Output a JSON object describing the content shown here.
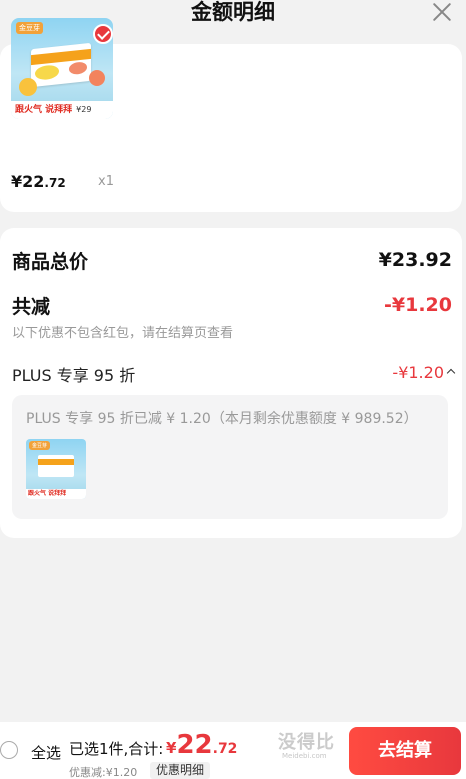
{
  "header": {
    "title": "金额明细"
  },
  "product": {
    "thumb_brand": "金豆芽",
    "thumb_slogan": "跟火气 说拜拜",
    "thumb_price": "¥29",
    "price_int": "¥22",
    "price_dec": ".72",
    "quantity": "x1"
  },
  "summary": {
    "total_label": "商品总价",
    "total_value": "¥23.92",
    "reduce_label": "共减",
    "reduce_value": "-¥1.20",
    "note": "以下优惠不包含红包，请在结算页查看",
    "plus_label": "PLUS 专享 95 折",
    "plus_value": "-¥1.20",
    "plus_detail": "PLUS 专享 95 折已减 ¥ 1.20（本月剩余优惠额度 ¥ 989.52）",
    "mini_brand": "金豆芽",
    "mini_slogan": "跟火气 说拜拜"
  },
  "bottom_bar": {
    "select_all": "全选",
    "selected_summary": "已选1件,合计:",
    "total_currency": "¥",
    "total_int": "22",
    "total_dec": ".72",
    "discount": "优惠减:¥1.20",
    "detail_chip": "优惠明细",
    "checkout": "去结算"
  },
  "watermark": {
    "main": "没得比",
    "sub": "Meidebi.com"
  },
  "colors": {
    "accent": "#e8383d",
    "background": "#f2f2f2"
  }
}
